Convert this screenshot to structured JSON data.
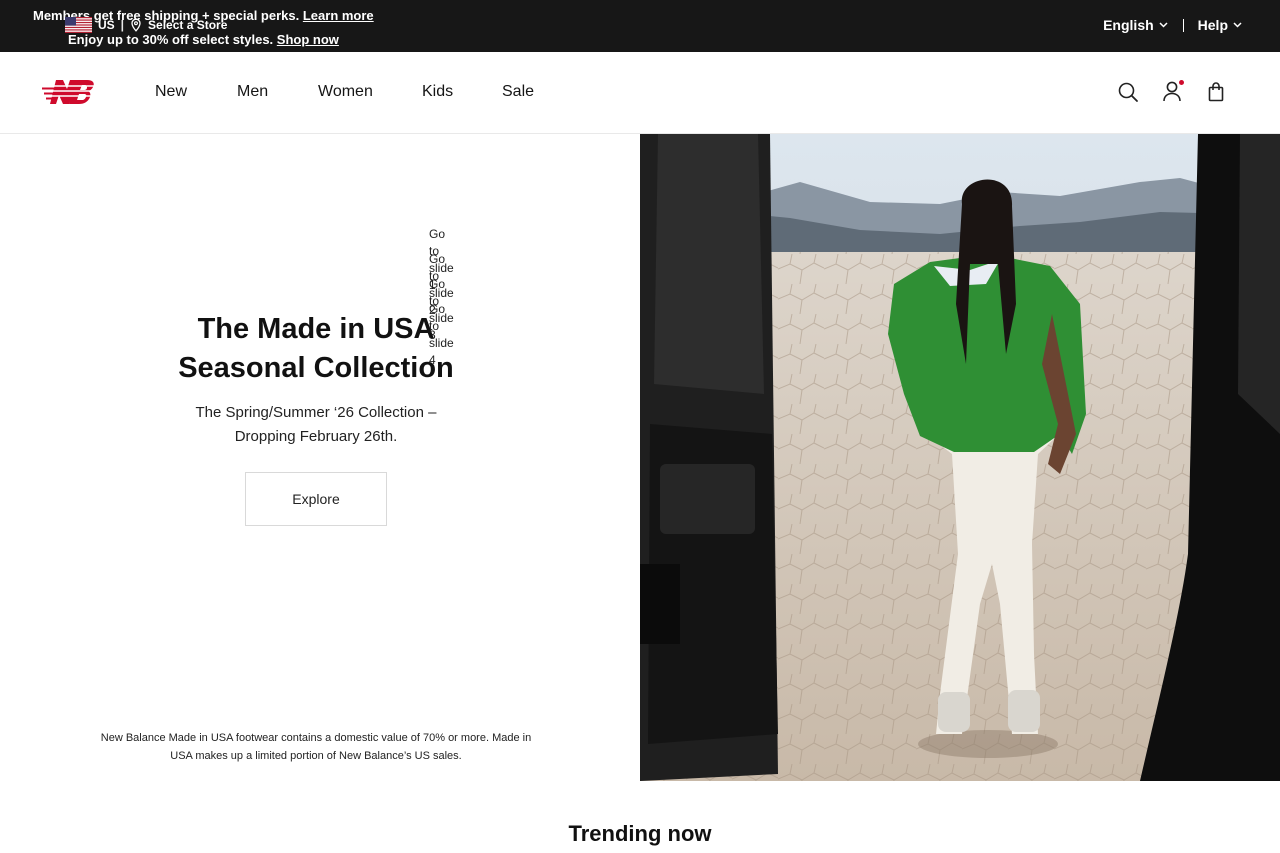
{
  "topbar": {
    "promo_line_1": "Members get free shipping + special perks.",
    "promo_link_1": "Learn more",
    "promo_line_2": "Enjoy up to 30% off select styles.",
    "promo_link_2": "Shop now",
    "country": "US",
    "store_label": "Select a Store",
    "language": "English",
    "help": "Help"
  },
  "header": {
    "nav": [
      {
        "label": "New"
      },
      {
        "label": "Men"
      },
      {
        "label": "Women"
      },
      {
        "label": "Kids"
      },
      {
        "label": "Sale"
      }
    ],
    "icons": [
      "search-icon",
      "account-icon",
      "cart-icon"
    ],
    "brand_color": "#CF0A2C"
  },
  "hero": {
    "title_line_1": "The Made in USA",
    "title_line_2": "Seasonal Collection",
    "subtitle": "The Spring/Summer ‘26 Collection – Dropping February 26th.",
    "cta": "Explore",
    "disclaimer": "New Balance Made in USA footwear contains a domestic value of 70% or more. Made in USA makes up a limited portion of New Balance’s US sales.",
    "slide_nav": [
      "Go to slide 1",
      "Go to slide 2",
      "Go to slide 3",
      "Go to slide 4"
    ]
  },
  "trending": {
    "title": "Trending now"
  }
}
